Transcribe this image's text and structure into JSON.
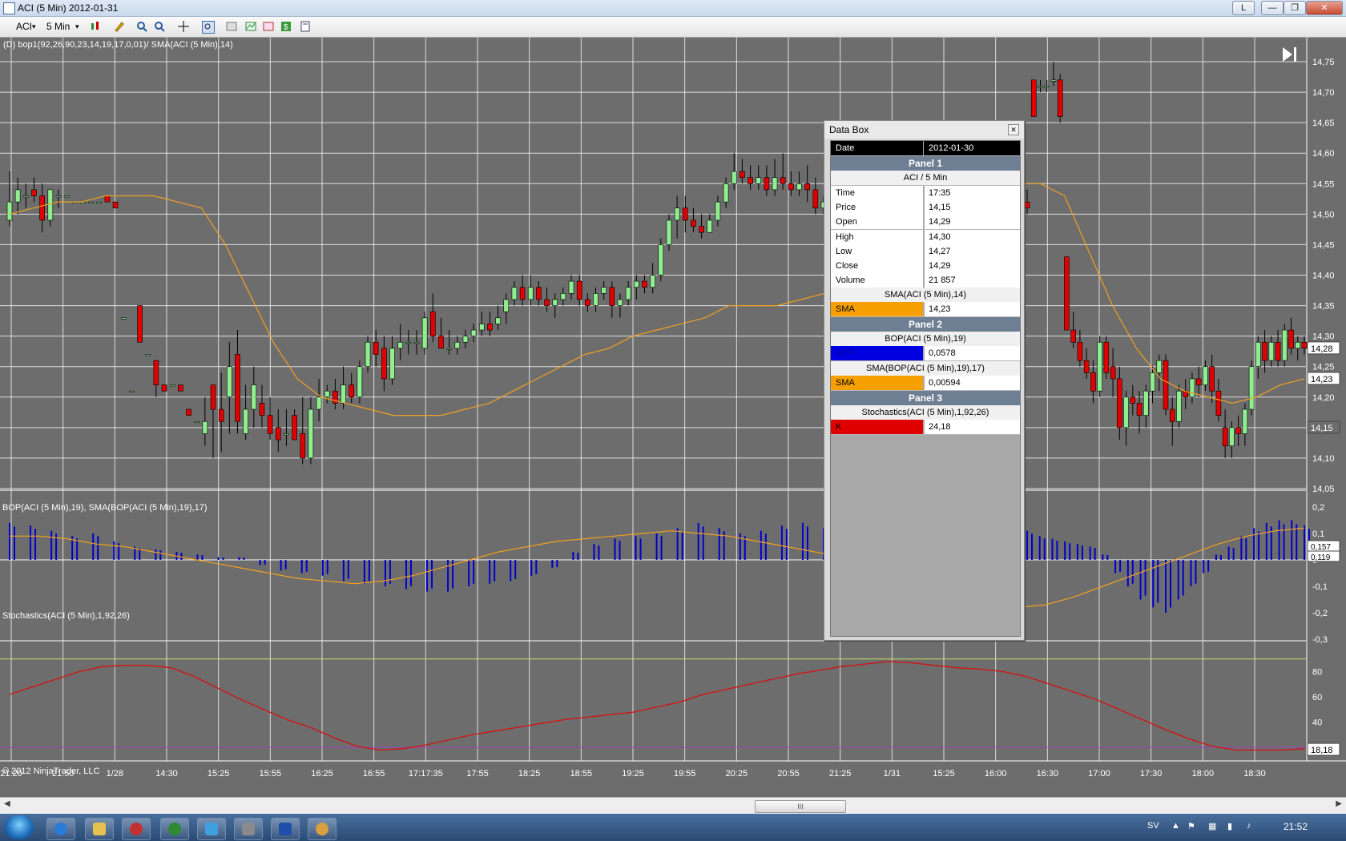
{
  "window": {
    "title": "ACI (5 Min)  2012-01-31",
    "lang_button": "L"
  },
  "toolbar": {
    "instrument": "ACI",
    "interval": "5 Min"
  },
  "colors": {
    "background": "#6d6d6d",
    "grid": "#f2f2f2",
    "up_candle": "#90ee90",
    "down_candle": "#e00000",
    "sma": "#f0a020",
    "bop_bar": "#0000cc",
    "stoch_k": "#d81010"
  },
  "panels": {
    "p1_label": "(D) bop1(92,26,90,23,14,19,17,0,01)/ SMA(ACI (5 Min),14)",
    "p2_label": "BOP(ACI (5 Min),19), SMA(BOP(ACI (5 Min),19),17)",
    "p3_label": "Stochastics(ACI (5 Min),1,92,26)",
    "copyright": "© 2012 NinjaTrader, LLC"
  },
  "chart_data": [
    {
      "type": "candlestick",
      "title": "ACI (5 Min)",
      "ylim": [
        14.05,
        14.75
      ],
      "y_ticks": [
        "14,05",
        "14,10",
        "14,15",
        "14,20",
        "14,25",
        "14,30",
        "14,35",
        "14,40",
        "14,45",
        "14,50",
        "14,55",
        "14,60",
        "14,65",
        "14,70",
        "14,75"
      ],
      "last_price_marker": "14,28",
      "sma_marker": "14,23",
      "cursor_price_marker": "14,15",
      "candles": [
        [
          14.49,
          14.57,
          14.48,
          14.52
        ],
        [
          14.52,
          14.56,
          14.5,
          14.54
        ],
        [
          14.53,
          14.55,
          14.51,
          14.53
        ],
        [
          14.54,
          14.56,
          14.52,
          14.53
        ],
        [
          14.53,
          14.55,
          14.47,
          14.49
        ],
        [
          14.49,
          14.54,
          14.48,
          14.54
        ],
        [
          14.53,
          14.54,
          14.51,
          14.53
        ],
        [
          14.53,
          14.53,
          14.53,
          14.53
        ],
        [
          14.52,
          14.52,
          14.52,
          14.52
        ],
        [
          14.52,
          14.52,
          14.52,
          14.52
        ],
        [
          14.52,
          14.52,
          14.52,
          14.52
        ],
        [
          14.52,
          14.52,
          14.52,
          14.52
        ],
        [
          14.53,
          14.53,
          14.52,
          14.52
        ],
        [
          14.52,
          14.52,
          14.51,
          14.51
        ],
        [
          14.33,
          14.33,
          14.33,
          14.33
        ],
        [
          14.21,
          14.21,
          14.21,
          14.21
        ],
        [
          14.35,
          14.35,
          14.29,
          14.29
        ],
        [
          14.27,
          14.27,
          14.27,
          14.27
        ],
        [
          14.26,
          14.26,
          14.2,
          14.22
        ],
        [
          14.22,
          14.22,
          14.21,
          14.21
        ],
        [
          14.22,
          14.22,
          14.22,
          14.22
        ],
        [
          14.22,
          14.22,
          14.21,
          14.21
        ],
        [
          14.18,
          14.18,
          14.17,
          14.17
        ],
        [
          14.16,
          14.16,
          14.16,
          14.16
        ],
        [
          14.14,
          14.2,
          14.12,
          14.16
        ],
        [
          14.22,
          14.22,
          14.1,
          14.18
        ],
        [
          14.18,
          14.24,
          14.11,
          14.16
        ],
        [
          14.2,
          14.29,
          14.14,
          14.25
        ],
        [
          14.27,
          14.31,
          14.14,
          14.16
        ],
        [
          14.14,
          14.22,
          14.13,
          14.18
        ],
        [
          14.18,
          14.25,
          14.15,
          14.22
        ],
        [
          14.19,
          14.22,
          14.15,
          14.17
        ],
        [
          14.17,
          14.2,
          14.13,
          14.14
        ],
        [
          14.15,
          14.18,
          14.11,
          14.13
        ],
        [
          14.14,
          14.18,
          14.12,
          14.14
        ],
        [
          14.17,
          14.18,
          14.13,
          14.13
        ],
        [
          14.14,
          14.2,
          14.09,
          14.1
        ],
        [
          14.1,
          14.2,
          14.09,
          14.18
        ],
        [
          14.18,
          14.23,
          14.16,
          14.2
        ],
        [
          14.2,
          14.22,
          14.19,
          14.21
        ],
        [
          14.21,
          14.23,
          14.18,
          14.19
        ],
        [
          14.19,
          14.25,
          14.18,
          14.22
        ],
        [
          14.22,
          14.24,
          14.19,
          14.2
        ],
        [
          14.2,
          14.26,
          14.19,
          14.25
        ],
        [
          14.25,
          14.3,
          14.24,
          14.29
        ],
        [
          14.29,
          14.31,
          14.25,
          14.27
        ],
        [
          14.28,
          14.3,
          14.21,
          14.23
        ],
        [
          14.23,
          14.3,
          14.22,
          14.28
        ],
        [
          14.28,
          14.32,
          14.26,
          14.29
        ],
        [
          14.29,
          14.31,
          14.27,
          14.29
        ],
        [
          14.29,
          14.31,
          14.27,
          14.29
        ],
        [
          14.28,
          14.34,
          14.27,
          14.33
        ],
        [
          14.34,
          14.37,
          14.29,
          14.3
        ],
        [
          14.3,
          14.33,
          14.28,
          14.28
        ],
        [
          14.28,
          14.31,
          14.27,
          14.28
        ],
        [
          14.28,
          14.3,
          14.27,
          14.29
        ],
        [
          14.29,
          14.31,
          14.28,
          14.3
        ],
        [
          14.3,
          14.32,
          14.29,
          14.31
        ],
        [
          14.31,
          14.34,
          14.3,
          14.32
        ],
        [
          14.32,
          14.34,
          14.3,
          14.31
        ],
        [
          14.32,
          14.35,
          14.31,
          14.33
        ],
        [
          14.34,
          14.37,
          14.32,
          14.36
        ],
        [
          14.36,
          14.39,
          14.35,
          14.38
        ],
        [
          14.38,
          14.4,
          14.35,
          14.36
        ],
        [
          14.36,
          14.4,
          14.35,
          14.38
        ],
        [
          14.38,
          14.39,
          14.35,
          14.36
        ],
        [
          14.36,
          14.38,
          14.34,
          14.35
        ],
        [
          14.35,
          14.37,
          14.33,
          14.36
        ],
        [
          14.36,
          14.38,
          14.35,
          14.37
        ],
        [
          14.37,
          14.4,
          14.36,
          14.39
        ],
        [
          14.39,
          14.4,
          14.35,
          14.36
        ],
        [
          14.36,
          14.37,
          14.34,
          14.35
        ],
        [
          14.35,
          14.38,
          14.34,
          14.37
        ],
        [
          14.37,
          14.39,
          14.36,
          14.38
        ],
        [
          14.38,
          14.39,
          14.33,
          14.35
        ],
        [
          14.35,
          14.37,
          14.33,
          14.36
        ],
        [
          14.36,
          14.39,
          14.35,
          14.38
        ],
        [
          14.38,
          14.4,
          14.36,
          14.39
        ],
        [
          14.39,
          14.4,
          14.37,
          14.38
        ],
        [
          14.38,
          14.42,
          14.37,
          14.4
        ],
        [
          14.4,
          14.46,
          14.39,
          14.45
        ],
        [
          14.45,
          14.5,
          14.44,
          14.49
        ],
        [
          14.49,
          14.53,
          14.46,
          14.51
        ],
        [
          14.51,
          14.53,
          14.47,
          14.49
        ],
        [
          14.49,
          14.51,
          14.47,
          14.48
        ],
        [
          14.48,
          14.5,
          14.46,
          14.47
        ],
        [
          14.47,
          14.5,
          14.47,
          14.49
        ],
        [
          14.49,
          14.53,
          14.48,
          14.52
        ],
        [
          14.52,
          14.56,
          14.51,
          14.55
        ],
        [
          14.55,
          14.6,
          14.54,
          14.57
        ],
        [
          14.57,
          14.59,
          14.55,
          14.56
        ],
        [
          14.56,
          14.58,
          14.54,
          14.55
        ],
        [
          14.55,
          14.58,
          14.54,
          14.56
        ],
        [
          14.56,
          14.58,
          14.53,
          14.54
        ],
        [
          14.54,
          14.59,
          14.53,
          14.56
        ],
        [
          14.56,
          14.6,
          14.54,
          14.55
        ],
        [
          14.55,
          14.57,
          14.53,
          14.54
        ],
        [
          14.54,
          14.57,
          14.53,
          14.55
        ],
        [
          14.55,
          14.58,
          14.52,
          14.54
        ],
        [
          14.54,
          14.56,
          14.5,
          14.51
        ],
        [
          14.51,
          14.53,
          14.5,
          14.52
        ],
        [
          14.52,
          14.54,
          14.5,
          14.51
        ],
        [
          14.72,
          14.72,
          14.66,
          14.66
        ],
        [
          14.71,
          14.72,
          14.7,
          14.71
        ],
        [
          14.71,
          14.72,
          14.7,
          14.71
        ],
        [
          14.72,
          14.75,
          14.71,
          14.72
        ],
        [
          14.72,
          14.73,
          14.65,
          14.66
        ],
        [
          14.43,
          14.43,
          14.31,
          14.31
        ],
        [
          14.31,
          14.34,
          14.28,
          14.29
        ],
        [
          14.29,
          14.31,
          14.25,
          14.26
        ],
        [
          14.26,
          14.28,
          14.23,
          14.24
        ],
        [
          14.24,
          14.26,
          14.19,
          14.21
        ],
        [
          14.21,
          14.3,
          14.2,
          14.29
        ],
        [
          14.29,
          14.3,
          14.23,
          14.24
        ],
        [
          14.25,
          14.28,
          14.2,
          14.23
        ],
        [
          14.23,
          14.25,
          14.13,
          14.15
        ],
        [
          14.15,
          14.21,
          14.12,
          14.2
        ],
        [
          14.2,
          14.22,
          14.17,
          14.19
        ],
        [
          14.19,
          14.21,
          14.14,
          14.17
        ],
        [
          14.17,
          14.22,
          14.15,
          14.21
        ],
        [
          14.21,
          14.25,
          14.19,
          14.24
        ],
        [
          14.24,
          14.27,
          14.21,
          14.26
        ],
        [
          14.26,
          14.27,
          14.17,
          14.18
        ],
        [
          14.18,
          14.2,
          14.12,
          14.16
        ],
        [
          14.16,
          14.22,
          14.15,
          14.21
        ],
        [
          14.21,
          14.23,
          14.18,
          14.2
        ],
        [
          14.2,
          14.24,
          14.19,
          14.23
        ],
        [
          14.23,
          14.25,
          14.2,
          14.22
        ],
        [
          14.22,
          14.26,
          14.21,
          14.25
        ],
        [
          14.25,
          14.27,
          14.19,
          14.21
        ],
        [
          14.21,
          14.23,
          14.16,
          14.17
        ],
        [
          14.15,
          14.18,
          14.1,
          14.12
        ],
        [
          14.12,
          14.16,
          14.1,
          14.15
        ],
        [
          14.15,
          14.17,
          14.12,
          14.14
        ],
        [
          14.14,
          14.19,
          14.12,
          14.18
        ],
        [
          14.18,
          14.26,
          14.17,
          14.25
        ],
        [
          14.25,
          14.3,
          14.23,
          14.29
        ],
        [
          14.29,
          14.31,
          14.24,
          14.26
        ],
        [
          14.26,
          14.3,
          14.25,
          14.29
        ],
        [
          14.29,
          14.31,
          14.25,
          14.26
        ],
        [
          14.26,
          14.32,
          14.25,
          14.31
        ],
        [
          14.31,
          14.33,
          14.27,
          14.28
        ],
        [
          14.28,
          14.3,
          14.26,
          14.29
        ],
        [
          14.29,
          14.3,
          14.27,
          14.28
        ]
      ],
      "sma": [
        14.5,
        14.51,
        14.52,
        14.52,
        14.53,
        14.53,
        14.53,
        14.52,
        14.51,
        14.45,
        14.37,
        14.29,
        14.23,
        14.2,
        14.19,
        14.18,
        14.17,
        14.17,
        14.17,
        14.18,
        14.19,
        14.21,
        14.23,
        14.25,
        14.27,
        14.28,
        14.3,
        14.31,
        14.32,
        14.33,
        14.35,
        14.35,
        14.35,
        14.36,
        14.37,
        14.39,
        14.41,
        14.44,
        14.47,
        14.5,
        14.52,
        14.54,
        14.55,
        14.55,
        14.53,
        14.44,
        14.35,
        14.28,
        14.23,
        14.21,
        14.2,
        14.19,
        14.2,
        14.22,
        14.23
      ]
    },
    {
      "type": "bar",
      "title": "BOP(ACI (5 Min),19), SMA(BOP(ACI (5 Min),19),17)",
      "ylim": [
        -0.3,
        0.2
      ],
      "y_ticks": [
        "0,2",
        "0,1",
        "0",
        "-0,1",
        "-0,2",
        "-0,3"
      ],
      "last_markers": [
        "0,157",
        "0,119"
      ],
      "bop": [
        0.14,
        0.13,
        0.11,
        0.09,
        0.1,
        0.07,
        0.05,
        0.04,
        0.03,
        0.02,
        0.01,
        0.01,
        -0.02,
        -0.04,
        -0.05,
        -0.06,
        -0.08,
        -0.09,
        -0.1,
        -0.11,
        -0.12,
        -0.12,
        -0.1,
        -0.09,
        -0.08,
        -0.06,
        -0.03,
        0.03,
        0.06,
        0.08,
        0.09,
        0.1,
        0.12,
        0.14,
        0.12,
        0.1,
        0.11,
        0.13,
        0.14,
        0.12,
        0.11,
        0.09,
        0.08,
        0.07,
        0.06,
        0.05,
        0.02,
        -0.05,
        -0.1,
        -0.15,
        -0.18,
        -0.2,
        -0.15,
        -0.1,
        -0.05,
        0.02,
        0.05,
        0.09,
        0.12,
        0.14,
        0.15,
        0.15,
        0.13
      ],
      "sma": [
        0.09,
        0.09,
        0.08,
        0.06,
        0.05,
        0.03,
        0.01,
        -0.01,
        -0.03,
        -0.05,
        -0.07,
        -0.08,
        -0.09,
        -0.08,
        -0.06,
        -0.03,
        0.0,
        0.03,
        0.05,
        0.07,
        0.08,
        0.09,
        0.1,
        0.11,
        0.1,
        0.09,
        0.07,
        0.05,
        0.03,
        0.01,
        -0.02,
        -0.06,
        -0.1,
        -0.14,
        -0.17,
        -0.18,
        -0.17,
        -0.14,
        -0.1,
        -0.06,
        -0.02,
        0.02,
        0.06,
        0.09,
        0.11,
        0.12
      ]
    },
    {
      "type": "line",
      "title": "Stochastics(ACI (5 Min),1,92,26)",
      "ylim": [
        10,
        100
      ],
      "y_ticks": [
        "80",
        "60",
        "40"
      ],
      "last_marker": "18,18",
      "k": [
        62,
        68,
        74,
        80,
        84,
        85,
        85,
        83,
        76,
        67,
        58,
        50,
        42,
        36,
        28,
        21,
        18,
        19,
        22,
        26,
        30,
        33,
        36,
        39,
        42,
        44,
        46,
        48,
        52,
        56,
        62,
        66,
        70,
        74,
        78,
        81,
        84,
        86,
        88,
        87,
        85,
        83,
        82,
        80,
        76,
        70,
        64,
        58,
        50,
        42,
        34,
        27,
        21,
        18,
        18,
        18,
        19
      ]
    },
    {
      "type": "axis",
      "x_tick_labels": [
        "21:20",
        "21:50",
        "1/28",
        "14:30",
        "15:25",
        "15:55",
        "16:25",
        "16:55",
        "17:17:35",
        "17:55",
        "18:25",
        "18:55",
        "19:25",
        "19:55",
        "20:25",
        "20:55",
        "21:25",
        "1/31",
        "15:25",
        "16:00",
        "16:30",
        "17:00",
        "17:30",
        "18:00",
        "18:30"
      ]
    }
  ],
  "databox": {
    "title": "Data Box",
    "date_label": "Date",
    "date_value": "2012-01-30",
    "panel1": "Panel 1",
    "panel1_sub": "ACI / 5 Min",
    "rows": [
      {
        "k": "Time",
        "v": "17:35"
      },
      {
        "k": "Price",
        "v": "14,15"
      },
      {
        "k": "Open",
        "v": "14,29"
      },
      {
        "k": "High",
        "v": "14,30"
      },
      {
        "k": "Low",
        "v": "14,27"
      },
      {
        "k": "Close",
        "v": "14,29"
      },
      {
        "k": "Volume",
        "v": "21 857"
      }
    ],
    "sma1_sub": "SMA(ACI (5 Min),14)",
    "sma1_k": "SMA",
    "sma1_v": "14,23",
    "panel2": "Panel 2",
    "bop_sub": "BOP(ACI (5 Min),19)",
    "bop_k": "BOP",
    "bop_v": "0,0578",
    "sma2_sub": "SMA(BOP(ACI (5 Min),19),17)",
    "sma2_k": "SMA",
    "sma2_v": "0,00594",
    "panel3": "Panel 3",
    "stoch_sub": "Stochastics(ACI (5 Min),1,92,26)",
    "k_k": "K",
    "k_v": "24,18"
  },
  "scrollbar": {
    "thumb_grip": "III"
  },
  "taskbar": {
    "lang": "SV",
    "clock": "21:52"
  }
}
